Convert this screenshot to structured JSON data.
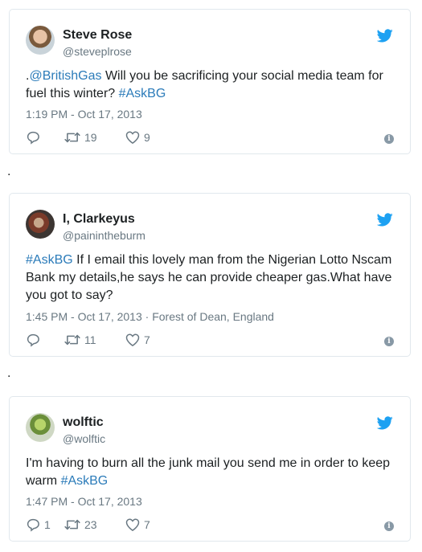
{
  "colors": {
    "link": "#2b7bb9",
    "muted": "#697882",
    "text": "#1c2022",
    "border": "#e1e8ed",
    "twitter_blue": "#1da1f2"
  },
  "separators": [
    ".",
    "."
  ],
  "tweets": [
    {
      "name": "Steve Rose",
      "handle": "@steveplrose",
      "text_prefix": ".",
      "mention": "@BritishGas",
      "text_body": " Will you be sacrificing your social media team for fuel this winter? ",
      "hashtag": "#AskBG",
      "timestamp": "1:19 PM - Oct 17, 2013",
      "location": "",
      "replies": "",
      "retweets": "19",
      "likes": "9"
    },
    {
      "name": "I, Clarkeyus",
      "handle": "@painintheburm",
      "hashtag": "#AskBG",
      "text_body": " If I email this lovely man from the Nigerian Lotto Nscam Bank my details,he says he can provide cheaper gas.What have you got to say?",
      "timestamp": "1:45 PM - Oct 17, 2013",
      "location": "Forest of Dean, England",
      "replies": "",
      "retweets": "11",
      "likes": "7"
    },
    {
      "name": "wolftic",
      "handle": "@wolftic",
      "text_body": "I'm having to burn all the junk mail you send me in order to keep warm ",
      "hashtag": "#AskBG",
      "timestamp": "1:47 PM - Oct 17, 2013",
      "location": "",
      "replies": "1",
      "retweets": "23",
      "likes": "7"
    }
  ],
  "icons": {
    "brand": "twitter-bird-icon",
    "reply": "reply-icon",
    "retweet": "retweet-icon",
    "like": "heart-icon",
    "info": "info-icon"
  }
}
